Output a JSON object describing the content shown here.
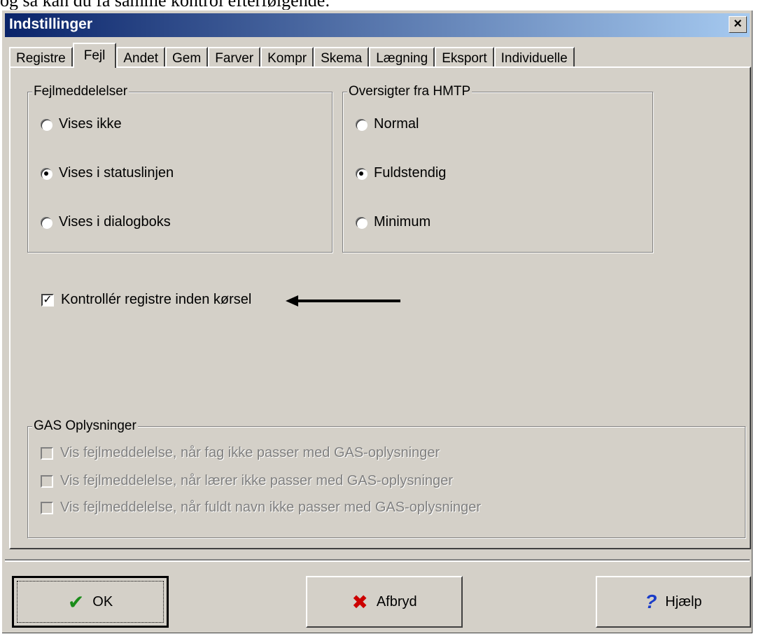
{
  "above_text": "og så kan du få samme kontrol efterfølgende:",
  "window": {
    "title": "Indstillinger",
    "close_label": "×"
  },
  "tabs": [
    {
      "label": "Registre",
      "active": false
    },
    {
      "label": "Fejl",
      "active": true
    },
    {
      "label": "Andet",
      "active": false
    },
    {
      "label": "Gem",
      "active": false
    },
    {
      "label": "Farver",
      "active": false
    },
    {
      "label": "Kompr",
      "active": false
    },
    {
      "label": "Skema",
      "active": false
    },
    {
      "label": "Lægning",
      "active": false
    },
    {
      "label": "Eksport",
      "active": false
    },
    {
      "label": "Individuelle",
      "active": false
    }
  ],
  "error_group": {
    "title": "Fejlmeddelelser",
    "options": [
      {
        "label": "Vises ikke",
        "selected": false
      },
      {
        "label": "Vises i statuslinjen",
        "selected": true
      },
      {
        "label": "Vises i dialogboks",
        "selected": false
      }
    ]
  },
  "overview_group": {
    "title": "Oversigter fra HMTP",
    "options": [
      {
        "label": "Normal",
        "selected": false
      },
      {
        "label": "Fuldstendig",
        "selected": true
      },
      {
        "label": "Minimum",
        "selected": false
      }
    ]
  },
  "check_registers": {
    "label": "Kontrollér registre inden kørsel",
    "checked": true
  },
  "gas_group": {
    "title": "GAS Oplysninger",
    "items": [
      "Vis fejlmeddelelse, når fag ikke passer med GAS-oplysninger",
      "Vis fejlmeddelelse, når lærer ikke passer med GAS-oplysninger",
      "Vis fejlmeddelelse, når fuldt navn ikke passer med GAS-oplysninger"
    ]
  },
  "buttons": {
    "ok": "OK",
    "cancel": "Afbryd",
    "help": "Hjælp"
  },
  "icons": {
    "ok": "check-icon",
    "cancel": "x-icon",
    "help": "question-icon"
  },
  "colors": {
    "titlebar_start": "#0a246a",
    "titlebar_end": "#a6caf0",
    "face": "#d4d0c8",
    "ok_icon": "#1a8c1a",
    "cancel_icon": "#cc0000",
    "help_icon": "#1a3cc8"
  }
}
